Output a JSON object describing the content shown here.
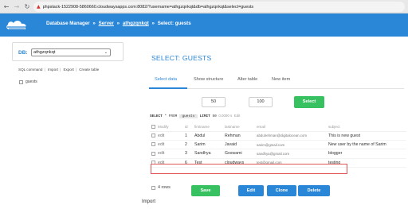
{
  "browser": {
    "url": "phpstack-1522908-5860660.cloudwaysapps.com:8082/?username=athgzqnkqt&db=athgzqnkqt&select=guests",
    "back_icon": "arrow-left-icon",
    "forward_icon": "arrow-right-icon",
    "reload_icon": "reload-icon",
    "lock_icon": "not-secure-icon"
  },
  "header": {
    "brand_color": "#2a86d6",
    "crumb_db_manager": "Database Manager",
    "crumb_server": "Server",
    "crumb_db": "athgzqnkqt",
    "crumb_select": "Select: guests",
    "separator": "»"
  },
  "sidebar": {
    "db_label": "DB:",
    "db_selected": "athgzqnkqt",
    "links": [
      "SQL command",
      "Import",
      "Export",
      "Create table"
    ],
    "tables": [
      "guests"
    ]
  },
  "main": {
    "title": "SELECT: GUESTS",
    "tabs": [
      "Select data",
      "Show structure",
      "Alter table",
      "New item"
    ],
    "active_tab": "Select data",
    "limit_value": "50",
    "text_length_value": "100",
    "select_button": "Select",
    "sql": {
      "select_kw": "SELECT",
      "star_from": "* FROM",
      "table": "`guests`",
      "limit_kw": "LIMIT",
      "limit_val": "50",
      "time": "0.0000 s",
      "edit": "Edit"
    },
    "columns": [
      "Modify",
      "id",
      "firstname",
      "lastname",
      "email",
      "subject"
    ],
    "rows": [
      {
        "modify": "edit",
        "id": "1",
        "firstname": "Abdul",
        "lastname": "Rehman",
        "email": "abdulrehman@digitalocean.com",
        "subject": "This is new guest"
      },
      {
        "modify": "edit",
        "id": "2",
        "firstname": "Sarim",
        "lastname": "Javaid",
        "email": "sarim@gmail.com",
        "subject": "New user by the name of Sarim"
      },
      {
        "modify": "edit",
        "id": "3",
        "firstname": "Sandhya",
        "lastname": "Goswami",
        "email": "sandhya@gmail.com",
        "subject": "blogger"
      },
      {
        "modify": "edit",
        "id": "6",
        "firstname": "Test",
        "lastname": "cloudways",
        "email": "test@gmail.com",
        "subject": "testing"
      }
    ],
    "row_count": "4 rows",
    "buttons": {
      "save": "Save",
      "edit": "Edit",
      "clone": "Clone",
      "delete": "Delete"
    },
    "import_label": "Import",
    "highlight_color": "#e05555",
    "green_color": "#37c161"
  }
}
